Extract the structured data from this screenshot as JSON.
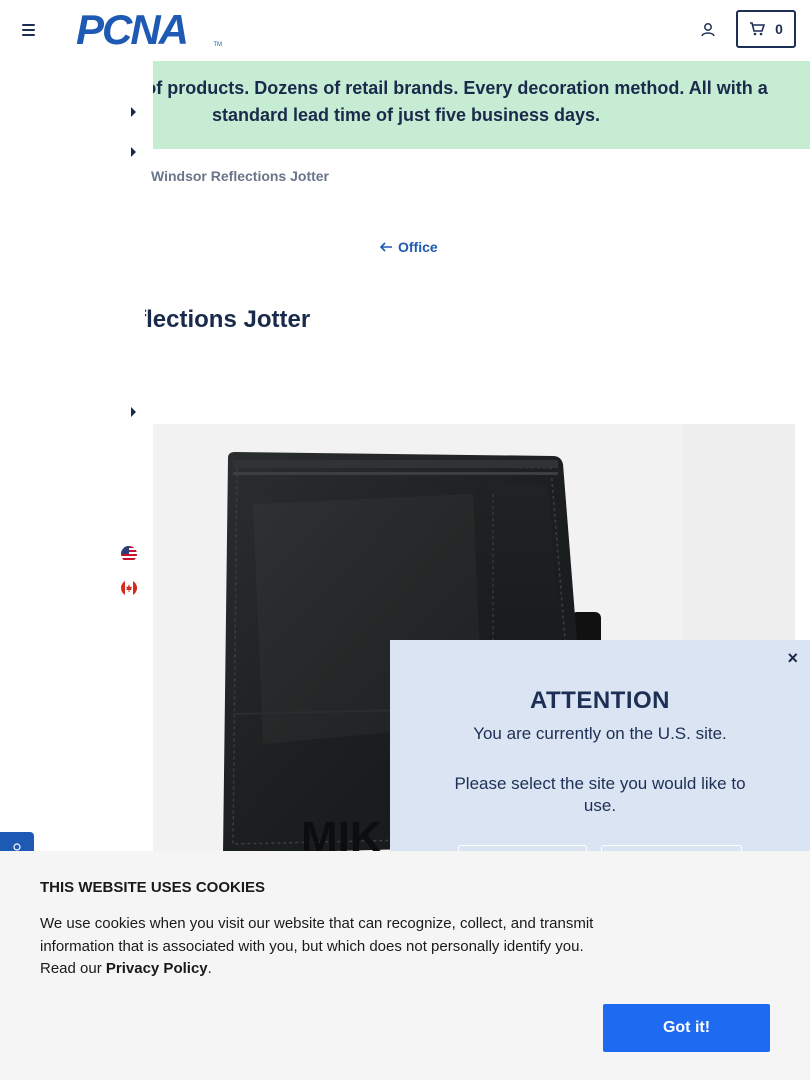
{
  "header": {
    "logo_text": "PCNA",
    "logo_tm": "TM",
    "cart_count": "0"
  },
  "banner": {
    "text": "Thousands of products. Dozens of retail brands. Every decoration method. All with a standard lead time of just five business days."
  },
  "breadcrumb": {
    "current": "Windsor Reflections Jotter"
  },
  "back_link": {
    "label": "Office"
  },
  "product": {
    "title": "Windsor Reflections Jotter",
    "image_imprint": "MIK"
  },
  "modal": {
    "title": "ATTENTION",
    "line1": "You are currently on the U.S. site.",
    "line2": "Please select the site you would like to use.",
    "close": "×"
  },
  "cookie": {
    "title": "THIS WEBSITE USES COOKIES",
    "text": "We use cookies when you visit our website that can recognize, collect, and transmit information that is associated with you, but which does not personally identify you. Read our",
    "link": "Privacy Policy",
    "period": ".",
    "button": "Got it!"
  },
  "icons": {
    "menu": "hamburger-icon",
    "account": "user-icon",
    "cart": "cart-icon",
    "back": "arrow-left-icon"
  },
  "colors": {
    "brand_blue": "#1e59b3",
    "navy": "#1d2f55",
    "banner_green": "#c6ecd4",
    "modal_bg": "#dbe4f2",
    "cookie_button": "#1e6af0"
  }
}
